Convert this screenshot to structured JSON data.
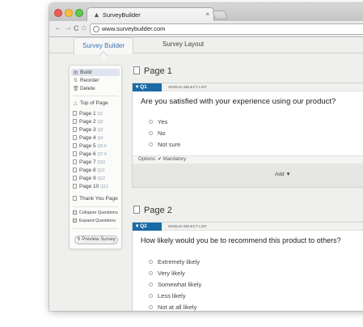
{
  "browser": {
    "tab_title": "SurveyBuilder",
    "tab_close": "×",
    "url": "www.surveybuilder.com",
    "nav": {
      "back": "←",
      "forward": "→",
      "reload": "C",
      "home": "⌂"
    }
  },
  "app_tabs": [
    {
      "label": "Survey Builder",
      "active": true
    },
    {
      "label": "Survey Layout",
      "active": false
    }
  ],
  "sidebar": {
    "actions": [
      {
        "icon": "build-icon",
        "glyph": "▤",
        "label": "Build",
        "selected": true
      },
      {
        "icon": "reorder-icon",
        "glyph": "⇅",
        "label": "Reorder",
        "selected": false
      },
      {
        "icon": "trash-icon",
        "glyph": "🗑",
        "label": "Delete",
        "selected": false
      }
    ],
    "top_of_page": {
      "glyph": "△",
      "label": "Top of Page"
    },
    "pages": [
      {
        "label": "Page 1",
        "range": "Q1"
      },
      {
        "label": "Page 2",
        "range": "Q2"
      },
      {
        "label": "Page 3",
        "range": "Q3"
      },
      {
        "label": "Page 4",
        "range": "Q4"
      },
      {
        "label": "Page 5",
        "range": "Q5-6"
      },
      {
        "label": "Page 6",
        "range": "Q7-9"
      },
      {
        "label": "Page 7",
        "range": "Q10"
      },
      {
        "label": "Page 8",
        "range": "Q11"
      },
      {
        "label": "Page 9",
        "range": "Q12"
      },
      {
        "label": "Page 10",
        "range": "Q13"
      }
    ],
    "thank_you": "Thank You Page",
    "collapse": "Collapse Questions",
    "expand": "Expand Questions",
    "preview": "Preview Survey"
  },
  "pages": [
    {
      "title": "Page 1",
      "question": {
        "tag": "Q1",
        "type": "SINGLE-SELECT LIST",
        "text": "Are you satisfied with your experience using our product?",
        "options": [
          "Yes",
          "No",
          "Not sure"
        ],
        "footer_options": "Options:",
        "footer_mandatory": "✔ Mandatory"
      },
      "add_label": "Add ▼"
    },
    {
      "title": "Page 2",
      "question": {
        "tag": "Q2",
        "type": "SINGLE-SELECT LIST",
        "text": "How likely would you be to recommend this product to others?",
        "options": [
          "Extremely likely",
          "Very likely",
          "Somewhat likely",
          "Less likely",
          "Not at all likely"
        ]
      }
    }
  ],
  "colors": {
    "accent": "#1a6aa5",
    "tab_active_text": "#3a77b6",
    "background": "#efefed"
  }
}
